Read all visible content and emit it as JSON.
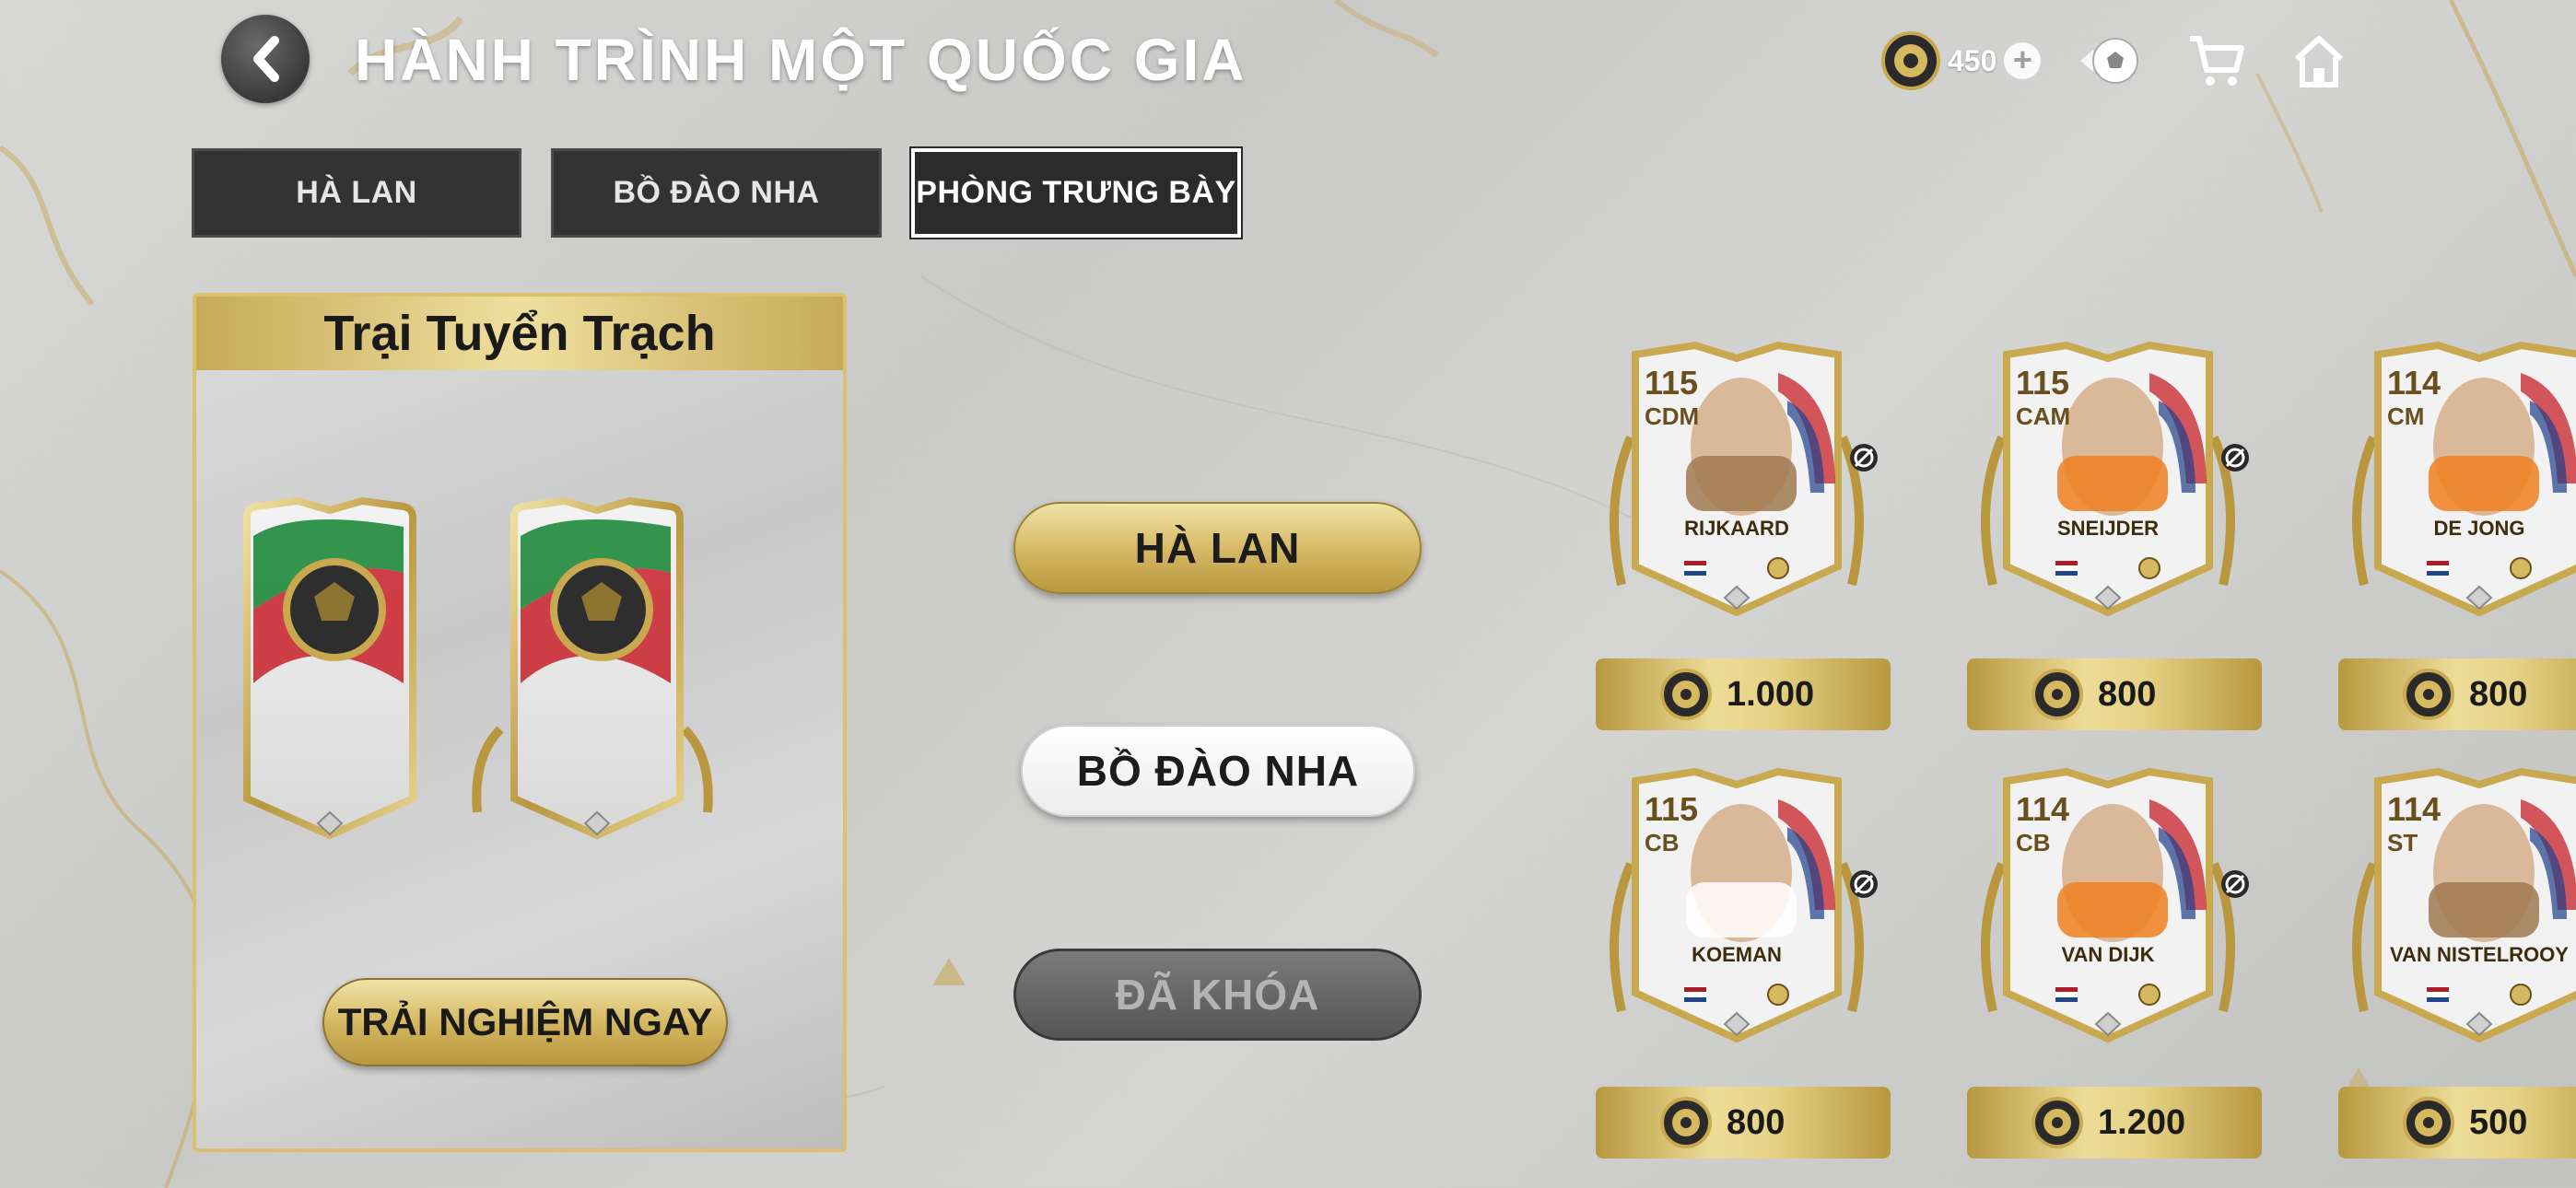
{
  "header": {
    "title": "HÀNH TRÌNH MỘT QUỐC GIA",
    "coins": "450",
    "icons": [
      "back-icon",
      "coin-icon",
      "plus-icon",
      "football-icon",
      "cart-icon",
      "home-icon"
    ]
  },
  "tabs": [
    {
      "label": "HÀ LAN",
      "active": false
    },
    {
      "label": "BỒ ĐÀO NHA",
      "active": false
    },
    {
      "label": "PHÒNG TRƯNG BÀY",
      "active": true
    }
  ],
  "panel": {
    "title": "Trại Tuyển Trạch",
    "button": "TRẢI NGHIỆM NGAY"
  },
  "nations": [
    {
      "label": "HÀ LAN",
      "state": "selected"
    },
    {
      "label": "BỒ ĐÀO NHA",
      "state": "available"
    },
    {
      "label": "ĐÃ KHÓA",
      "state": "locked"
    }
  ],
  "players": [
    {
      "ovr": "115",
      "pos": "CDM",
      "name": "RIJKAARD",
      "price": "1.000"
    },
    {
      "ovr": "115",
      "pos": "CAM",
      "name": "SNEIJDER",
      "price": "800"
    },
    {
      "ovr": "114",
      "pos": "CM",
      "name": "DE JONG",
      "price": "800"
    },
    {
      "ovr": "115",
      "pos": "CB",
      "name": "KOEMAN",
      "price": "800"
    },
    {
      "ovr": "114",
      "pos": "CB",
      "name": "VAN DIJK",
      "price": "1.200"
    },
    {
      "ovr": "114",
      "pos": "ST",
      "name": "VAN NISTELROOY",
      "price": "500"
    }
  ],
  "colors": {
    "gold": "#d6ba67",
    "dark_tab": "#333333",
    "title_white": "#ffffff"
  }
}
